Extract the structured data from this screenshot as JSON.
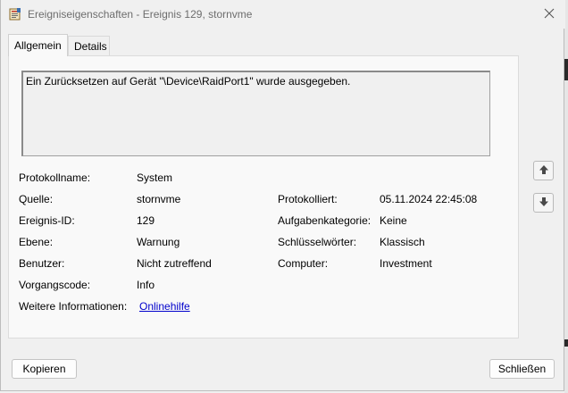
{
  "window": {
    "title": "Ereigniseigenschaften - Ereignis 129, stornvme"
  },
  "tabs": [
    {
      "label": "Allgemein",
      "active": true
    },
    {
      "label": "Details",
      "active": false
    }
  ],
  "message": "Ein Zurücksetzen auf Gerät \"\\Device\\RaidPort1\" wurde ausgegeben.",
  "properties": {
    "log_name": {
      "label": "Protokollname:",
      "value": "System"
    },
    "source": {
      "label": "Quelle:",
      "value": "stornvme"
    },
    "logged": {
      "label": "Protokolliert:",
      "value": "05.11.2024 22:45:08"
    },
    "event_id": {
      "label": "Ereignis-ID:",
      "value": "129"
    },
    "task_category": {
      "label": "Aufgabenkategorie:",
      "value": "Keine"
    },
    "level": {
      "label": "Ebene:",
      "value": "Warnung"
    },
    "keywords": {
      "label": "Schlüsselwörter:",
      "value": "Klassisch"
    },
    "user": {
      "label": "Benutzer:",
      "value": "Nicht zutreffend"
    },
    "computer": {
      "label": "Computer:",
      "value": "Investment"
    },
    "opcode": {
      "label": "Vorgangscode:",
      "value": "Info"
    },
    "more_info": {
      "label": "Weitere Informationen:",
      "link": "Onlinehilfe"
    }
  },
  "buttons": {
    "copy": "Kopieren",
    "close": "Schließen"
  },
  "icons": {
    "title": "event-properties-icon",
    "close": "close-icon",
    "up": "arrow-up-icon",
    "down": "arrow-down-icon"
  }
}
